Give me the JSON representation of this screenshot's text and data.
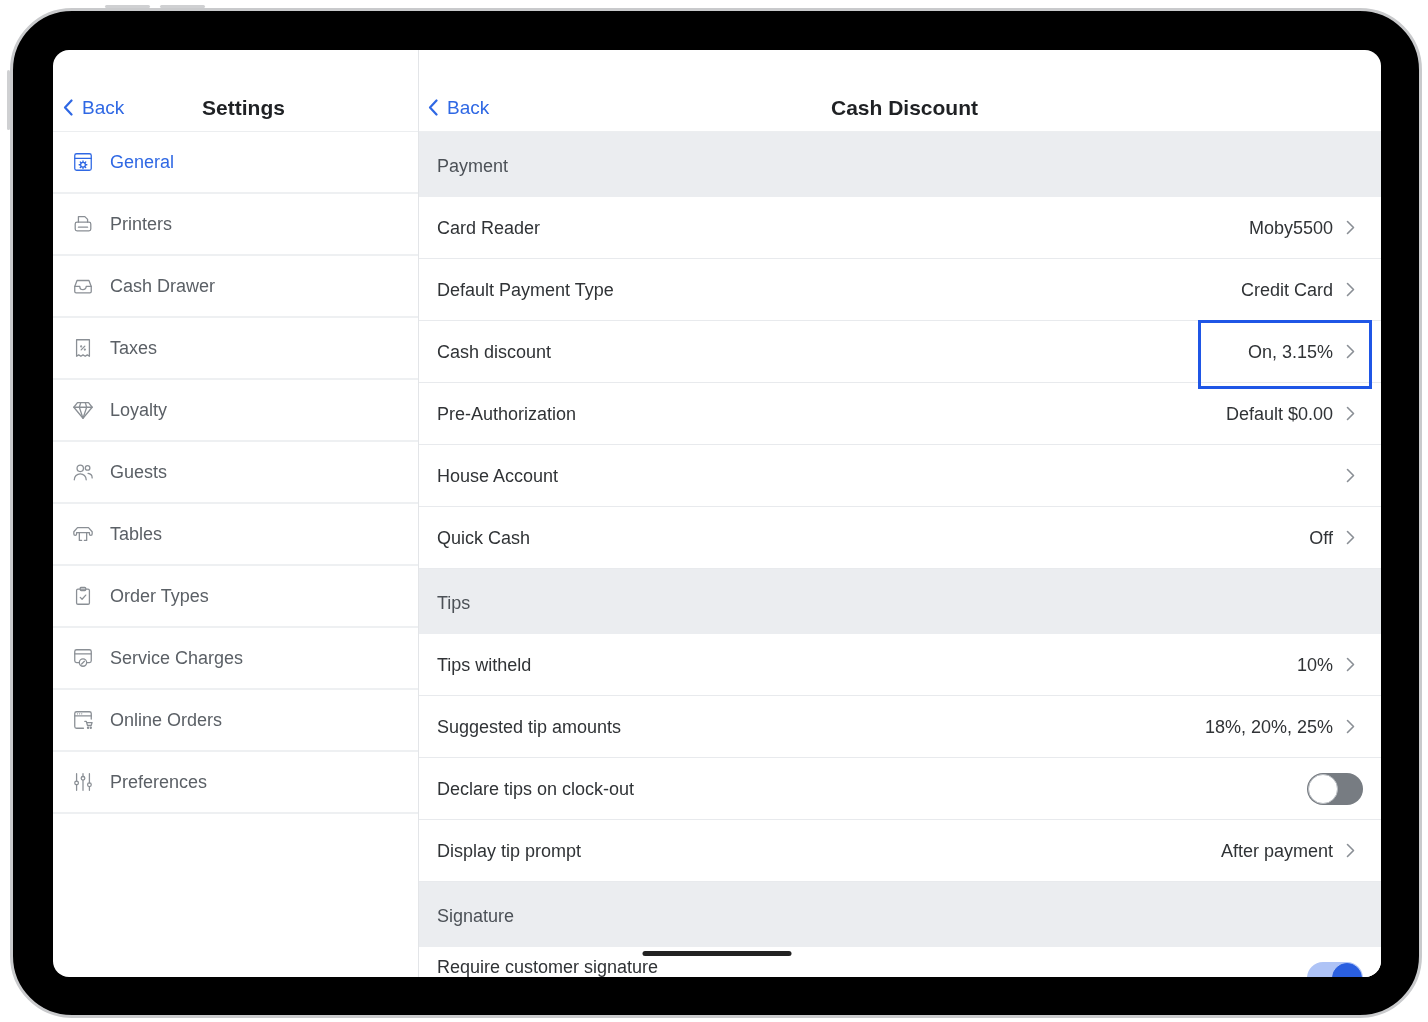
{
  "sidebar": {
    "back": "Back",
    "title": "Settings",
    "items": [
      {
        "label": "General",
        "selected": true
      },
      {
        "label": "Printers",
        "selected": false
      },
      {
        "label": "Cash Drawer",
        "selected": false
      },
      {
        "label": "Taxes",
        "selected": false
      },
      {
        "label": "Loyalty",
        "selected": false
      },
      {
        "label": "Guests",
        "selected": false
      },
      {
        "label": "Tables",
        "selected": false
      },
      {
        "label": "Order Types",
        "selected": false
      },
      {
        "label": "Service Charges",
        "selected": false
      },
      {
        "label": "Online Orders",
        "selected": false
      },
      {
        "label": "Preferences",
        "selected": false
      }
    ]
  },
  "detail": {
    "back": "Back",
    "title": "Cash Discount",
    "sections": [
      {
        "title": "Payment",
        "rows": [
          {
            "kind": "link",
            "label": "Card Reader",
            "value": "Moby5500",
            "highlighted": false
          },
          {
            "kind": "link",
            "label": "Default Payment Type",
            "value": "Credit Card",
            "highlighted": false
          },
          {
            "kind": "link",
            "label": "Cash discount",
            "value": "On, 3.15%",
            "highlighted": true
          },
          {
            "kind": "link",
            "label": "Pre-Authorization",
            "value": "Default $0.00",
            "highlighted": false
          },
          {
            "kind": "link",
            "label": "House Account",
            "highlighted": false
          },
          {
            "kind": "link",
            "label": "Quick Cash",
            "value": "Off",
            "highlighted": false
          }
        ]
      },
      {
        "title": "Tips",
        "rows": [
          {
            "kind": "link",
            "label": "Tips witheld",
            "value": "10%",
            "highlighted": false
          },
          {
            "kind": "link",
            "label": "Suggested tip amounts",
            "value": "18%, 20%, 25%",
            "highlighted": false
          },
          {
            "kind": "toggle",
            "label": "Declare tips on clock-out",
            "on": false,
            "highlighted": false
          },
          {
            "kind": "link",
            "label": "Display tip prompt",
            "value": "After payment",
            "highlighted": false
          }
        ]
      },
      {
        "title": "Signature",
        "rows": [
          {
            "kind": "toggle",
            "label": "Require customer signature",
            "on": true,
            "highlighted": false
          }
        ]
      }
    ]
  }
}
